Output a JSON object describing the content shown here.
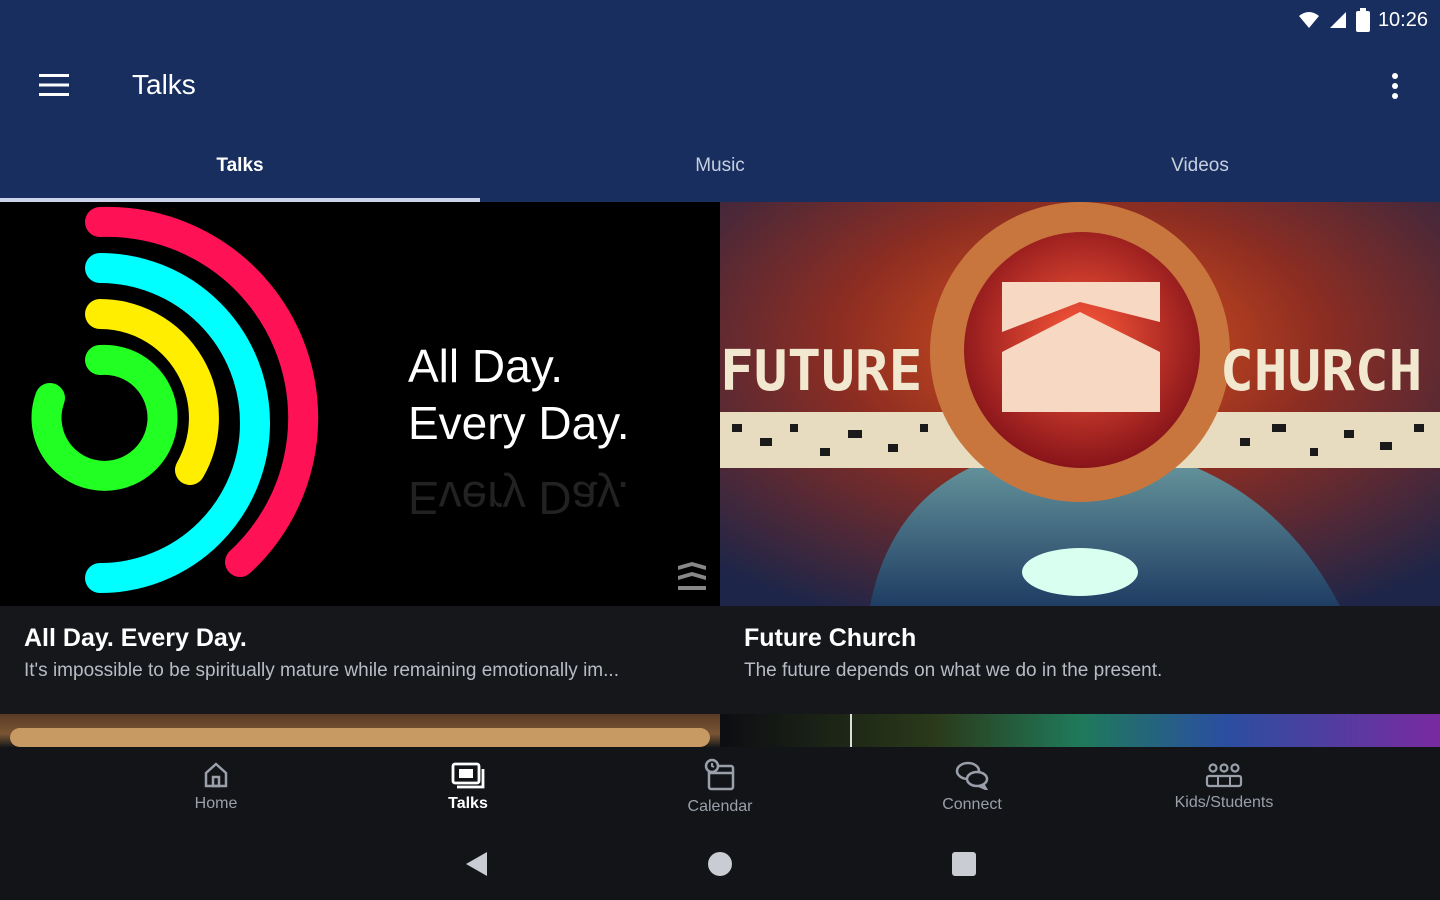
{
  "status": {
    "time": "10:26"
  },
  "appbar": {
    "title": "Talks"
  },
  "tabs": [
    {
      "label": "Talks",
      "active": true
    },
    {
      "label": "Music",
      "active": false
    },
    {
      "label": "Videos",
      "active": false
    }
  ],
  "cards": [
    {
      "title": "All Day. Every Day.",
      "description": "It's impossible to be spiritually mature while remaining emotionally im...",
      "artwork": {
        "line1": "All Day.",
        "line2": "Every Day.",
        "reflection": "Every Day."
      }
    },
    {
      "title": "Future Church",
      "description": "The future depends on what we do in the present.",
      "artwork": {
        "word_left": "FUTURE",
        "word_right": "CHURCH"
      }
    }
  ],
  "bottom_nav": [
    {
      "label": "Home",
      "icon": "home-icon",
      "active": false
    },
    {
      "label": "Talks",
      "icon": "talks-icon",
      "active": true
    },
    {
      "label": "Calendar",
      "icon": "calendar-icon",
      "active": false
    },
    {
      "label": "Connect",
      "icon": "connect-icon",
      "active": false
    },
    {
      "label": "Kids/Students",
      "icon": "kids-icon",
      "active": false
    }
  ],
  "colors": {
    "primary": "#172e5e",
    "background": "#121418",
    "ring_red": "#ff1155",
    "ring_cyan": "#00ffff",
    "ring_yellow": "#ffee00",
    "ring_green": "#22ff22"
  }
}
